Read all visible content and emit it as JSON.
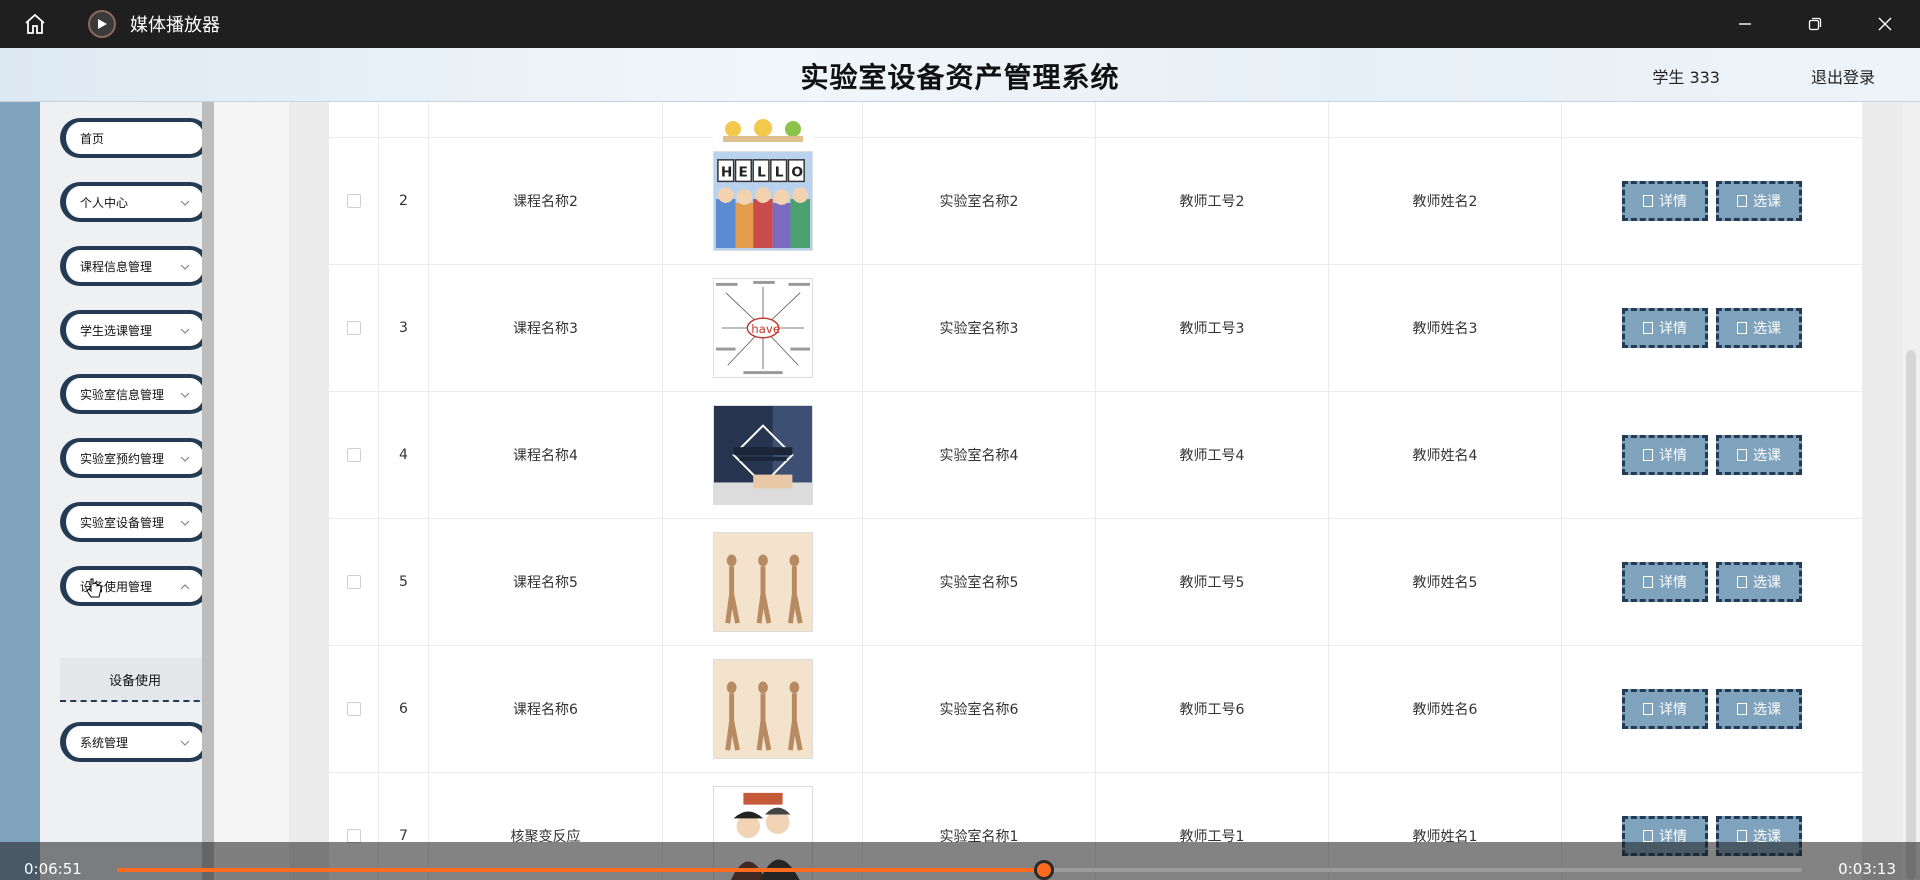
{
  "player": {
    "title": "媒体播放器",
    "time_elapsed": "0:06:51",
    "time_total": "0:03:13",
    "progress": 0.55
  },
  "app": {
    "title": "实验室设备资产管理系统",
    "user": "学生 333",
    "logout": "退出登录"
  },
  "sidebar": {
    "items": [
      {
        "label": "首页"
      },
      {
        "label": "个人中心"
      },
      {
        "label": "课程信息管理"
      },
      {
        "label": "学生选课管理"
      },
      {
        "label": "实验室信息管理"
      },
      {
        "label": "实验室预约管理"
      },
      {
        "label": "实验室设备管理"
      },
      {
        "label": "设备使用管理"
      },
      {
        "label": "系统管理"
      }
    ],
    "submenu_label": "设备使用"
  },
  "table": {
    "detail_label": "详情",
    "select_label": "选课",
    "rows": [
      {
        "num": "2",
        "course": "课程名称2",
        "lab": "实验室名称2",
        "teacher_no": "教师工号2",
        "teacher_name": "教师姓名2"
      },
      {
        "num": "3",
        "course": "课程名称3",
        "lab": "实验室名称3",
        "teacher_no": "教师工号3",
        "teacher_name": "教师姓名3"
      },
      {
        "num": "4",
        "course": "课程名称4",
        "lab": "实验室名称4",
        "teacher_no": "教师工号4",
        "teacher_name": "教师姓名4"
      },
      {
        "num": "5",
        "course": "课程名称5",
        "lab": "实验室名称5",
        "teacher_no": "教师工号5",
        "teacher_name": "教师姓名5"
      },
      {
        "num": "6",
        "course": "课程名称6",
        "lab": "实验室名称6",
        "teacher_no": "教师工号6",
        "teacher_name": "教师姓名6"
      },
      {
        "num": "7",
        "course": "核聚变反应",
        "lab": "实验室名称1",
        "teacher_no": "教师工号1",
        "teacher_name": "教师姓名1"
      }
    ]
  },
  "colors": {
    "accent": "#7fa3bd",
    "dark": "#243b55",
    "progress": "#ff6a1f"
  }
}
